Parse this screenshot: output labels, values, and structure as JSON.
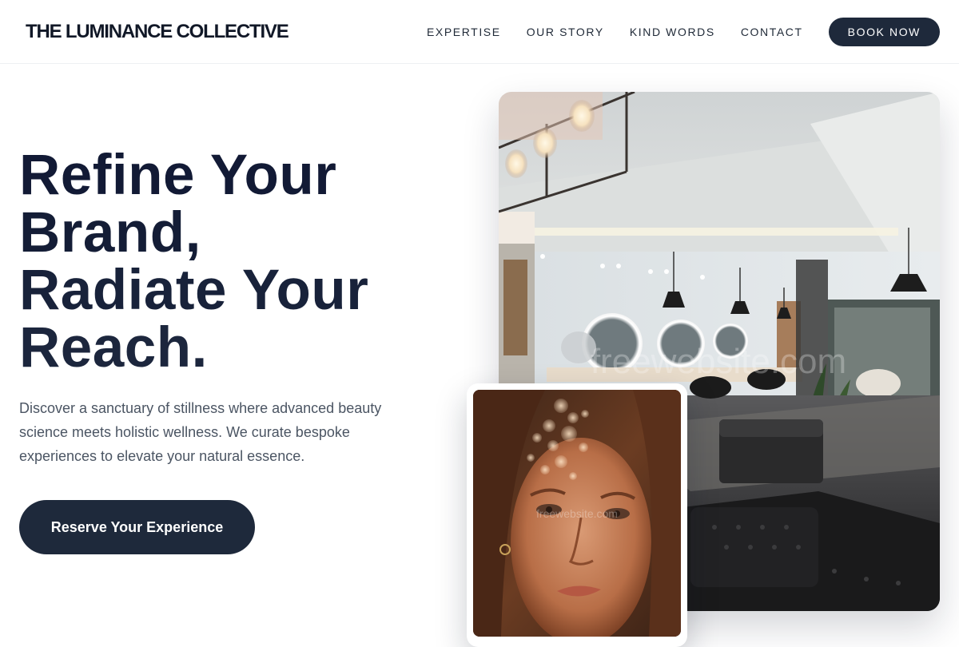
{
  "header": {
    "brand": "THE LUMINANCE COLLECTIVE",
    "nav": [
      {
        "label": "EXPERTISE"
      },
      {
        "label": "OUR STORY"
      },
      {
        "label": "KIND WORDS"
      },
      {
        "label": "CONTACT"
      }
    ],
    "book_label": "BOOK NOW"
  },
  "hero": {
    "title_lines": [
      "Refine Your",
      "Brand,",
      "Radiate Your",
      "Reach."
    ],
    "description": "Discover a sanctuary of stillness where advanced beauty science meets holistic wellness. We curate bespoke experiences to elevate your natural essence.",
    "cta_label": "Reserve Your Experience"
  },
  "images": {
    "salon_watermark": "freewebsite.com",
    "portrait_watermark": "freewebsite.com"
  },
  "colors": {
    "primary": "#1e293b",
    "heading": "#111a33",
    "body_text": "#4b5563"
  }
}
